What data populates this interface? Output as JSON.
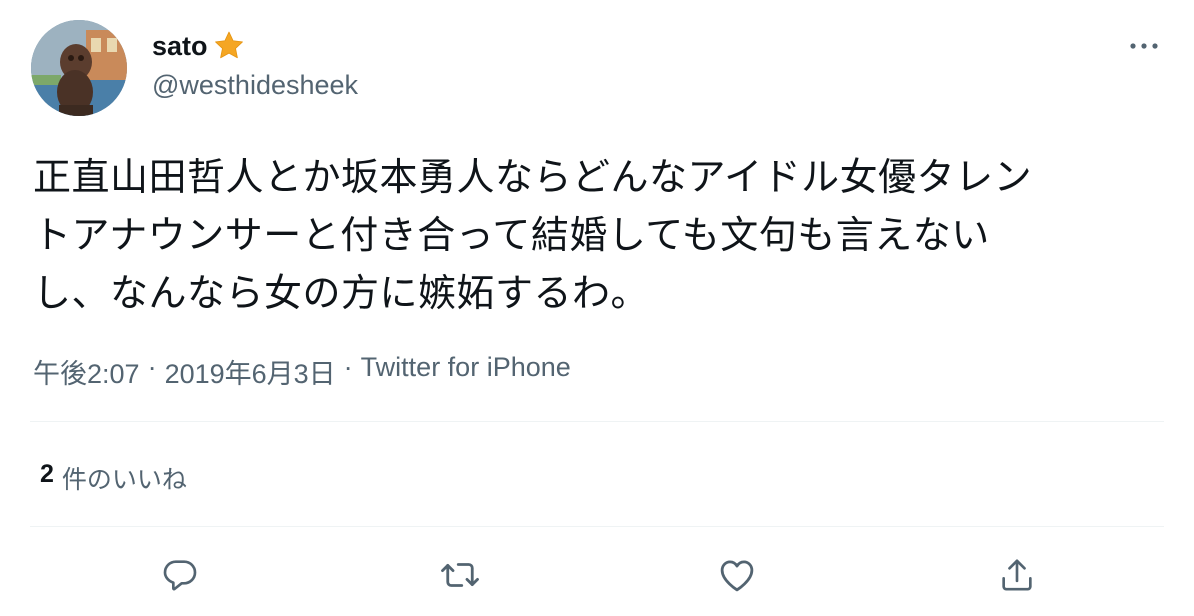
{
  "user": {
    "display_name": "sato",
    "badge_icon": "star-emoji-icon",
    "handle": "@westhidesheek"
  },
  "tweet": {
    "lines": [
      "正直山田哲人とか坂本勇人ならどんなアイドル女優タレン",
      "トアナウンサーと付き合って結婚しても文句も言えない",
      "し、なんなら女の方に嫉妬するわ。"
    ],
    "time": "午後2:07",
    "separator": "·",
    "date": "2019年6月3日",
    "source": "Twitter for iPhone"
  },
  "stats": {
    "likes_count": "2",
    "likes_label": "件のいいね"
  },
  "actions": [
    {
      "name": "reply",
      "icon": "reply-icon"
    },
    {
      "name": "retweet",
      "icon": "retweet-icon"
    },
    {
      "name": "like",
      "icon": "heart-icon"
    },
    {
      "name": "share",
      "icon": "share-icon"
    }
  ],
  "colors": {
    "text_primary": "#0f1419",
    "text_secondary": "#536471",
    "divider": "#eff3f4",
    "icon": "#536471",
    "star": "#f5a623"
  }
}
